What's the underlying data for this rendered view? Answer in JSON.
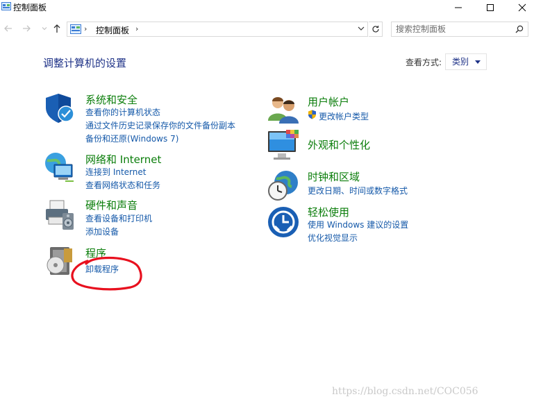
{
  "window": {
    "title": "控制面板"
  },
  "address": {
    "path_segment": "控制面板",
    "search_placeholder": "搜索控制面板"
  },
  "main": {
    "heading": "调整计算机的设置",
    "view_by_label": "查看方式:",
    "view_by_value": "类别"
  },
  "categories": {
    "system_security": {
      "title": "系统和安全",
      "links": [
        "查看你的计算机状态",
        "通过文件历史记录保存你的文件备份副本",
        "备份和还原(Windows 7)"
      ]
    },
    "network": {
      "title": "网络和 Internet",
      "links": [
        "连接到 Internet",
        "查看网络状态和任务"
      ]
    },
    "hardware_sound": {
      "title": "硬件和声音",
      "links": [
        "查看设备和打印机",
        "添加设备"
      ]
    },
    "programs": {
      "title": "程序",
      "links": [
        "卸载程序"
      ]
    },
    "user_accounts": {
      "title": "用户帐户",
      "links": [
        "更改帐户类型"
      ]
    },
    "appearance": {
      "title": "外观和个性化"
    },
    "clock_region": {
      "title": "时钟和区域",
      "links": [
        "更改日期、时间或数字格式"
      ]
    },
    "ease_of_access": {
      "title": "轻松使用",
      "links": [
        "使用 Windows 建议的设置",
        "优化视觉显示"
      ]
    }
  },
  "watermark": "https://blog.csdn.net/COC056",
  "colors": {
    "heading": "#1e3287",
    "category_title": "#0a7d0a",
    "link": "#1559a9",
    "annotation": "#e8101e"
  }
}
